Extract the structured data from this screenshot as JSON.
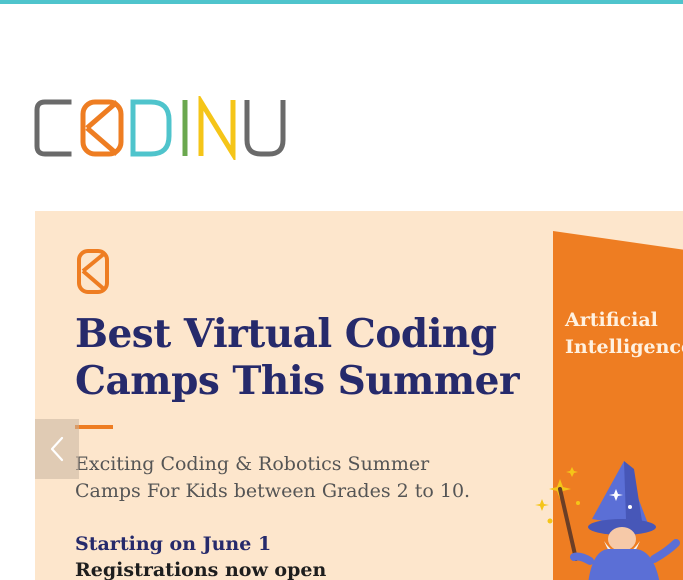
{
  "brand": {
    "name": "CODINU",
    "accent": "#4fc4cc",
    "letter_colors": [
      "#6a6a6a",
      "#ee7d22",
      "#4fc4cc",
      "#6ba84f",
      "#f5c518",
      "#6a6a6a"
    ]
  },
  "hero": {
    "background": "#fde6cc",
    "title_line1": "Best Virtual Coding",
    "title_line2": "Camps This Summer",
    "subtitle_line1": "Exciting Coding & Robotics Summer",
    "subtitle_line2": "Camps For Kids between Grades 2 to 10.",
    "start_text": "Starting on June 1",
    "registration_text": "Registrations now open",
    "side_text_line1": "Artificial",
    "side_text_line2": "Intelligence",
    "side_color": "#ee7d22",
    "title_color": "#262a6b"
  },
  "carousel": {
    "prev_icon": "chevron-left-icon"
  }
}
